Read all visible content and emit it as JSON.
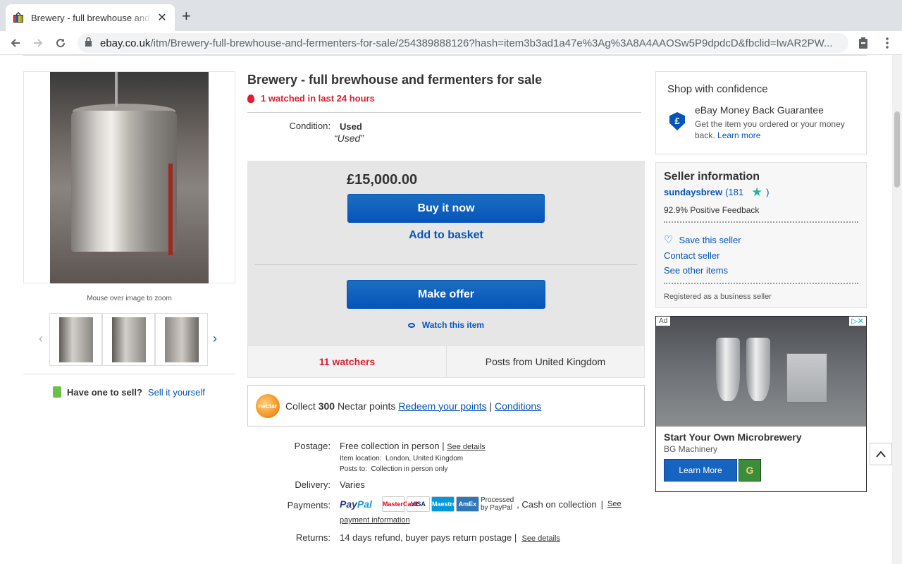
{
  "browser": {
    "tab_title": "Brewery - full brewhouse and f",
    "tab_close": "✕",
    "new_tab": "+",
    "url_host": "ebay.co.uk",
    "url_path": "/itm/Brewery-full-brewhouse-and-fermenters-for-sale/254389888126?hash=item3b3ad1a47e%3Ag%3A8A4AAOSw5P9dpdcD&fbclid=IwAR2PW..."
  },
  "gallery": {
    "zoom_note": "Mouse over image to zoom",
    "prev": "‹",
    "next": "›",
    "sell_question": "Have one to sell?",
    "sell_link": "Sell it yourself"
  },
  "item": {
    "title": "Brewery - full brewhouse and fermenters for sale",
    "watched_24h": "1 watched in last 24 hours",
    "condition_label": "Condition:",
    "condition_value": "Used",
    "condition_note": "“Used”",
    "price": "£15,000.00",
    "buy_now": "Buy it now",
    "add_basket": "Add to basket",
    "make_offer": "Make offer",
    "watch_item": "Watch this item",
    "watchers": "11 watchers",
    "posts_from": "Posts from United Kingdom"
  },
  "nectar": {
    "logo": "nectar",
    "prefix": "Collect ",
    "points": "300",
    "suffix": " Nectar points ",
    "redeem": "Redeem your points",
    "divider": " | ",
    "conditions": "Conditions"
  },
  "shipping": {
    "postage_label": "Postage:",
    "postage_value": "Free collection in person",
    "postage_sep": " | ",
    "see_details": "See details",
    "location_label": "Item location:",
    "location_value": "London, United Kingdom",
    "posts_to_label": "Posts to:",
    "posts_to_value": "Collection in person only",
    "delivery_label": "Delivery:",
    "delivery_value": "Varies",
    "payments_label": "Payments:",
    "paypal_a": "Pay",
    "paypal_b": "Pal",
    "cards": [
      "MasterCard",
      "VISA",
      "Maestro",
      "AmEx"
    ],
    "processed_1": "Processed",
    "processed_2": "by PayPal",
    "cash": ",  Cash on collection",
    "pay_sep": " | ",
    "see_payment_1": "See",
    "see_payment_2": "payment information",
    "returns_label": "Returns:",
    "returns_value": "14 days refund, buyer pays return postage",
    "returns_sep": " | ",
    "returns_details": "See details"
  },
  "confidence": {
    "title": "Shop with confidence",
    "shield": "£",
    "guarantee": "eBay Money Back Guarantee",
    "desc": "Get the item you ordered or your money back.",
    "learn": "Learn more"
  },
  "seller": {
    "heading": "Seller information",
    "name": "sundaysbrew",
    "score_open": "(181",
    "score_close": ")",
    "feedback": "92.9% Positive Feedback",
    "save": "Save this seller",
    "contact": "Contact seller",
    "other": "See other items",
    "registered": "Registered as a business seller"
  },
  "ad": {
    "tag": "Ad",
    "close": "▷✕",
    "title": "Start Your Own Microbrewery",
    "company": "BG Machinery",
    "cta": "Learn More",
    "logo": "G"
  },
  "colors": {
    "link": "#0654ba",
    "alert": "#dd1e31",
    "button": "#0654ba"
  }
}
